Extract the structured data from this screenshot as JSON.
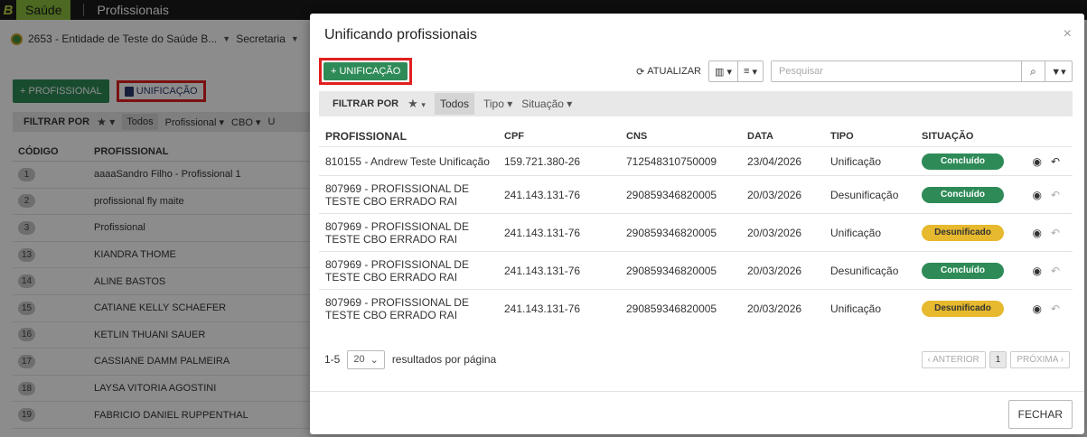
{
  "topbar": {
    "brand_letter": "B",
    "app_name": "Saúde",
    "module": "Profissionais"
  },
  "background": {
    "entity": "2653 - Entidade de Teste do Saúde B...",
    "secretaria": "Secretaria",
    "add_button": "+ PROFISSIONAL",
    "unif_button": "UNIFICAÇÃO",
    "filter": {
      "label": "FILTRAR POR",
      "todos": "Todos",
      "dd1": "Profissional",
      "dd2": "CBO",
      "dd3": "U"
    },
    "table_headers": [
      "CÓDIGO",
      "PROFISSIONAL"
    ],
    "rows": [
      {
        "code": "1",
        "name": "aaaaSandro Filho - Profissional 1"
      },
      {
        "code": "2",
        "name": "profissional fly maite"
      },
      {
        "code": "3",
        "name": "Profissional"
      },
      {
        "code": "13",
        "name": "KIANDRA THOME"
      },
      {
        "code": "14",
        "name": "ALINE BASTOS"
      },
      {
        "code": "15",
        "name": "CATIANE KELLY SCHAEFER"
      },
      {
        "code": "16",
        "name": "KETLIN THUANI SAUER"
      },
      {
        "code": "17",
        "name": "CASSIANE DAMM PALMEIRA"
      },
      {
        "code": "18",
        "name": "LAYSA VITORIA AGOSTINI"
      },
      {
        "code": "19",
        "name": "FABRICIO DANIEL RUPPENTHAL"
      }
    ]
  },
  "modal": {
    "title": "Unificando profissionais",
    "close_glyph": "×",
    "add_button": "+ UNIFICAÇÃO",
    "refresh_label": "ATUALIZAR",
    "search_placeholder": "Pesquisar",
    "filter": {
      "label": "FILTRAR POR",
      "todos": "Todos",
      "tipo": "Tipo",
      "situacao": "Situação"
    },
    "headers": {
      "profissional": "PROFISSIONAL",
      "cpf": "CPF",
      "cns": "CNS",
      "data": "DATA",
      "tipo": "TIPO",
      "situacao": "SITUAÇÃO"
    },
    "rows": [
      {
        "prof": "810155 - Andrew Teste Unificação",
        "cpf": "159.721.380-26",
        "cns": "712548310750009",
        "data": "23/04/2026",
        "tipo": "Unificação",
        "situacao": "Concluído"
      },
      {
        "prof": "807969 - PROFISSIONAL DE TESTE CBO ERRADO RAI",
        "cpf": "241.143.131-76",
        "cns": "290859346820005",
        "data": "20/03/2026",
        "tipo": "Desunificação",
        "situacao": "Concluído"
      },
      {
        "prof": "807969 - PROFISSIONAL DE TESTE CBO ERRADO RAI",
        "cpf": "241.143.131-76",
        "cns": "290859346820005",
        "data": "20/03/2026",
        "tipo": "Unificação",
        "situacao": "Desunificado"
      },
      {
        "prof": "807969 - PROFISSIONAL DE TESTE CBO ERRADO RAI",
        "cpf": "241.143.131-76",
        "cns": "290859346820005",
        "data": "20/03/2026",
        "tipo": "Desunificação",
        "situacao": "Concluído"
      },
      {
        "prof": "807969 - PROFISSIONAL DE TESTE CBO ERRADO RAI",
        "cpf": "241.143.131-76",
        "cns": "290859346820005",
        "data": "20/03/2026",
        "tipo": "Unificação",
        "situacao": "Desunificado"
      }
    ],
    "pager": {
      "range": "1-5",
      "per_page": "20",
      "per_page_label": "resultados por página",
      "prev": "‹ ANTERIOR",
      "current": "1",
      "next": "PRÓXIMA ›"
    },
    "footer_close": "FECHAR"
  },
  "colors": {
    "green": "#2e8b57",
    "yellow": "#e6b92e",
    "highlight_red": "#e02020"
  }
}
